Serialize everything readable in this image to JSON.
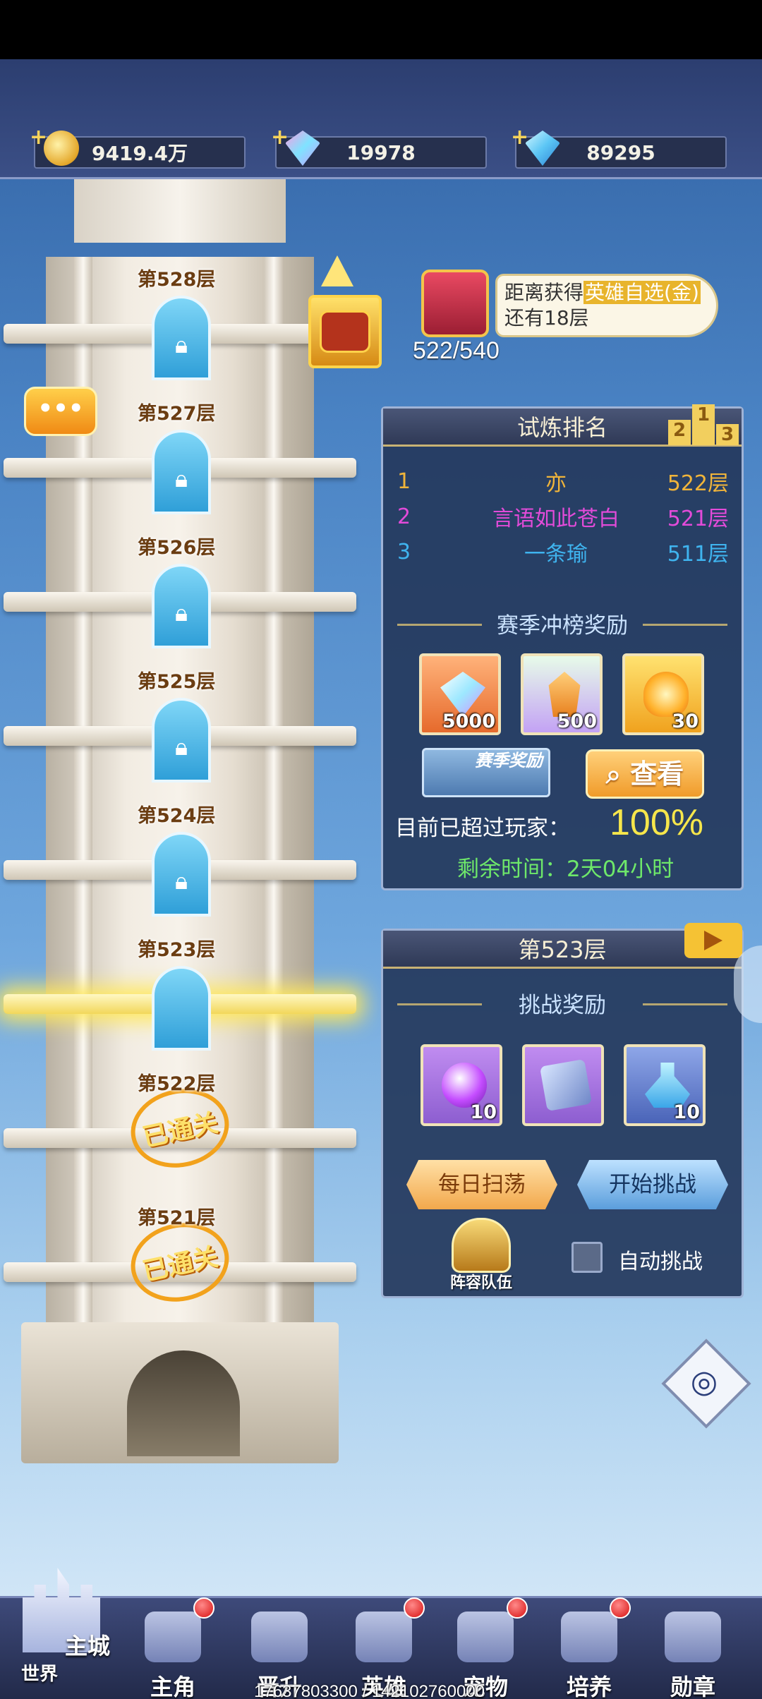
{
  "resources": [
    {
      "icon": "gold-coin-icon",
      "value": "9419.4万"
    },
    {
      "icon": "rainbow-gem-icon",
      "value": "19978"
    },
    {
      "icon": "blue-diamond-icon",
      "value": "89295"
    }
  ],
  "tower": {
    "floors": [
      {
        "label": "第528层",
        "state": "locked"
      },
      {
        "label": "第527层",
        "state": "locked"
      },
      {
        "label": "第526层",
        "state": "locked"
      },
      {
        "label": "第525层",
        "state": "locked"
      },
      {
        "label": "第524层",
        "state": "locked"
      },
      {
        "label": "第523层",
        "state": "current"
      },
      {
        "label": "第522层",
        "state": "passed"
      },
      {
        "label": "第521层",
        "state": "passed"
      }
    ],
    "passed_stamp": "已通关",
    "chat_icon_text": "•••"
  },
  "progress": {
    "text_prefix": "距离获得",
    "highlight": "英雄自选(金)",
    "text_suffix": "还有18层",
    "count": "522/540"
  },
  "ranking": {
    "title": "试炼排名",
    "podium": [
      "2",
      "1",
      "3"
    ],
    "rows": [
      {
        "rank": "1",
        "name": "亦",
        "level": "522层",
        "color": "#f0b43a"
      },
      {
        "rank": "2",
        "name": "言语如此苍白",
        "level": "521层",
        "color": "#e24bd9"
      },
      {
        "rank": "3",
        "name": "一条瑜",
        "level": "511层",
        "color": "#3fb4ef"
      }
    ],
    "season_title": "赛季冲榜奖励",
    "season_rewards": [
      {
        "icon": "crystal-gem-icon",
        "qty": "5000"
      },
      {
        "icon": "orange-crystal-icon",
        "qty": "500"
      },
      {
        "icon": "fire-essence-icon",
        "qty": "30"
      }
    ],
    "season_button": "赛季奖励",
    "view_button": "查看",
    "surpass_label": "目前已超过玩家：",
    "surpass_value": "100%",
    "remaining": "剩余时间：2天04小时"
  },
  "floor_panel": {
    "title": "第523层",
    "rewards_title": "挑战奖励",
    "rewards": [
      {
        "icon": "purple-orb-icon",
        "qty": "10"
      },
      {
        "icon": "rune-card-icon",
        "qty": ""
      },
      {
        "icon": "potion-bottle-icon",
        "qty": "10"
      }
    ],
    "daily_button": "每日扫荡",
    "start_button": "开始挑战",
    "lineup_label": "阵容队伍",
    "auto_label": "自动挑战"
  },
  "nav": {
    "world_main": "主城",
    "world_sub": "世界",
    "items": [
      {
        "label": "主角",
        "icon": "hero-head-icon",
        "dot": true
      },
      {
        "label": "晋升",
        "icon": "wings-emblem-icon",
        "dot": false
      },
      {
        "label": "英雄",
        "icon": "helmet-icon",
        "dot": true
      },
      {
        "label": "宠物",
        "icon": "beast-icon",
        "dot": true
      },
      {
        "label": "培养",
        "icon": "compass-icon",
        "dot": true
      },
      {
        "label": "勋章",
        "icon": "medal-icon",
        "dot": false
      }
    ]
  },
  "footer": "17637803300 / 142102760000"
}
